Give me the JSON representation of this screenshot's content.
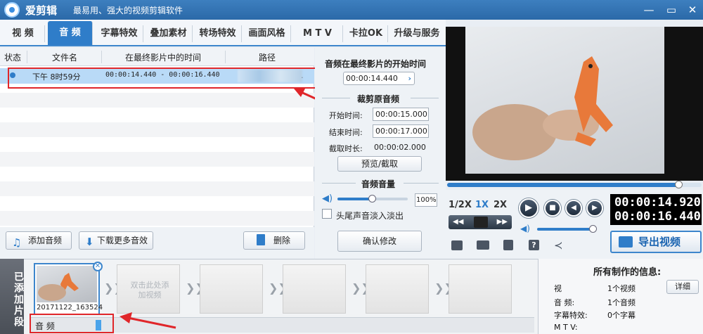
{
  "app": {
    "name": "爱剪辑",
    "subtitle": "最易用、强大的视频剪辑软件"
  },
  "tabs": [
    {
      "label": "视 频",
      "active": false
    },
    {
      "label": "音 频",
      "active": true
    },
    {
      "label": "字幕特效",
      "active": false
    },
    {
      "label": "叠加素材",
      "active": false
    },
    {
      "label": "转场特效",
      "active": false
    },
    {
      "label": "画面风格",
      "active": false
    },
    {
      "label": "M T V",
      "active": false
    },
    {
      "label": "卡拉OK",
      "active": false
    },
    {
      "label": "升级与服务",
      "active": false
    }
  ],
  "table": {
    "headers": {
      "status": "状态",
      "filename": "文件名",
      "time": "在最终影片中的时间",
      "path": "路径"
    },
    "row": {
      "filename": "下午 8时59分",
      "time": "00:00:14.440 - 00:00:16.440",
      "path_suffix": "."
    }
  },
  "left_buttons": {
    "add_audio": "添加音频",
    "download_more": "下载更多音效",
    "delete": "删除"
  },
  "audio_panel": {
    "start_title": "音频在最终影片的开始时间",
    "start_value": "00:00:14.440",
    "trim_title": "裁剪原音频",
    "start_label": "开始时间:",
    "start_time": "00:00:15.000",
    "end_label": "结束时间:",
    "end_time": "00:00:17.000",
    "duration_label": "截取时长:",
    "duration_value": "00:00:02.000",
    "preview_button": "预览/截取",
    "volume_title": "音频音量",
    "volume_value": "100%",
    "volume_level": 0.5,
    "fade_label": "头尾声音淡入淡出",
    "confirm_button": "确认修改"
  },
  "player": {
    "progress": 0.91,
    "speeds": [
      "1/2X",
      "1X",
      "2X"
    ],
    "current_time": "00:00:14.920",
    "total_time": "00:00:16.440",
    "export_label": "导出视频"
  },
  "timeline": {
    "sidebar_label": "已添加片段",
    "clip_name": "20171122_163524",
    "placeholder": "双击此处添加视频",
    "audio_label": "音 频"
  },
  "info": {
    "title": "所有制作的信息:",
    "detail_button": "详细",
    "rows": [
      {
        "label": "视",
        "value": "1个视频"
      },
      {
        "label": "音 频:",
        "value": "1个音频"
      },
      {
        "label": "字幕特效:",
        "value": "0个字幕"
      },
      {
        "label": "M T V:",
        "value": ""
      }
    ]
  },
  "colors": {
    "accent": "#2f7dc9",
    "highlight": "#e0262a",
    "selected_row": "#b9daf7"
  }
}
